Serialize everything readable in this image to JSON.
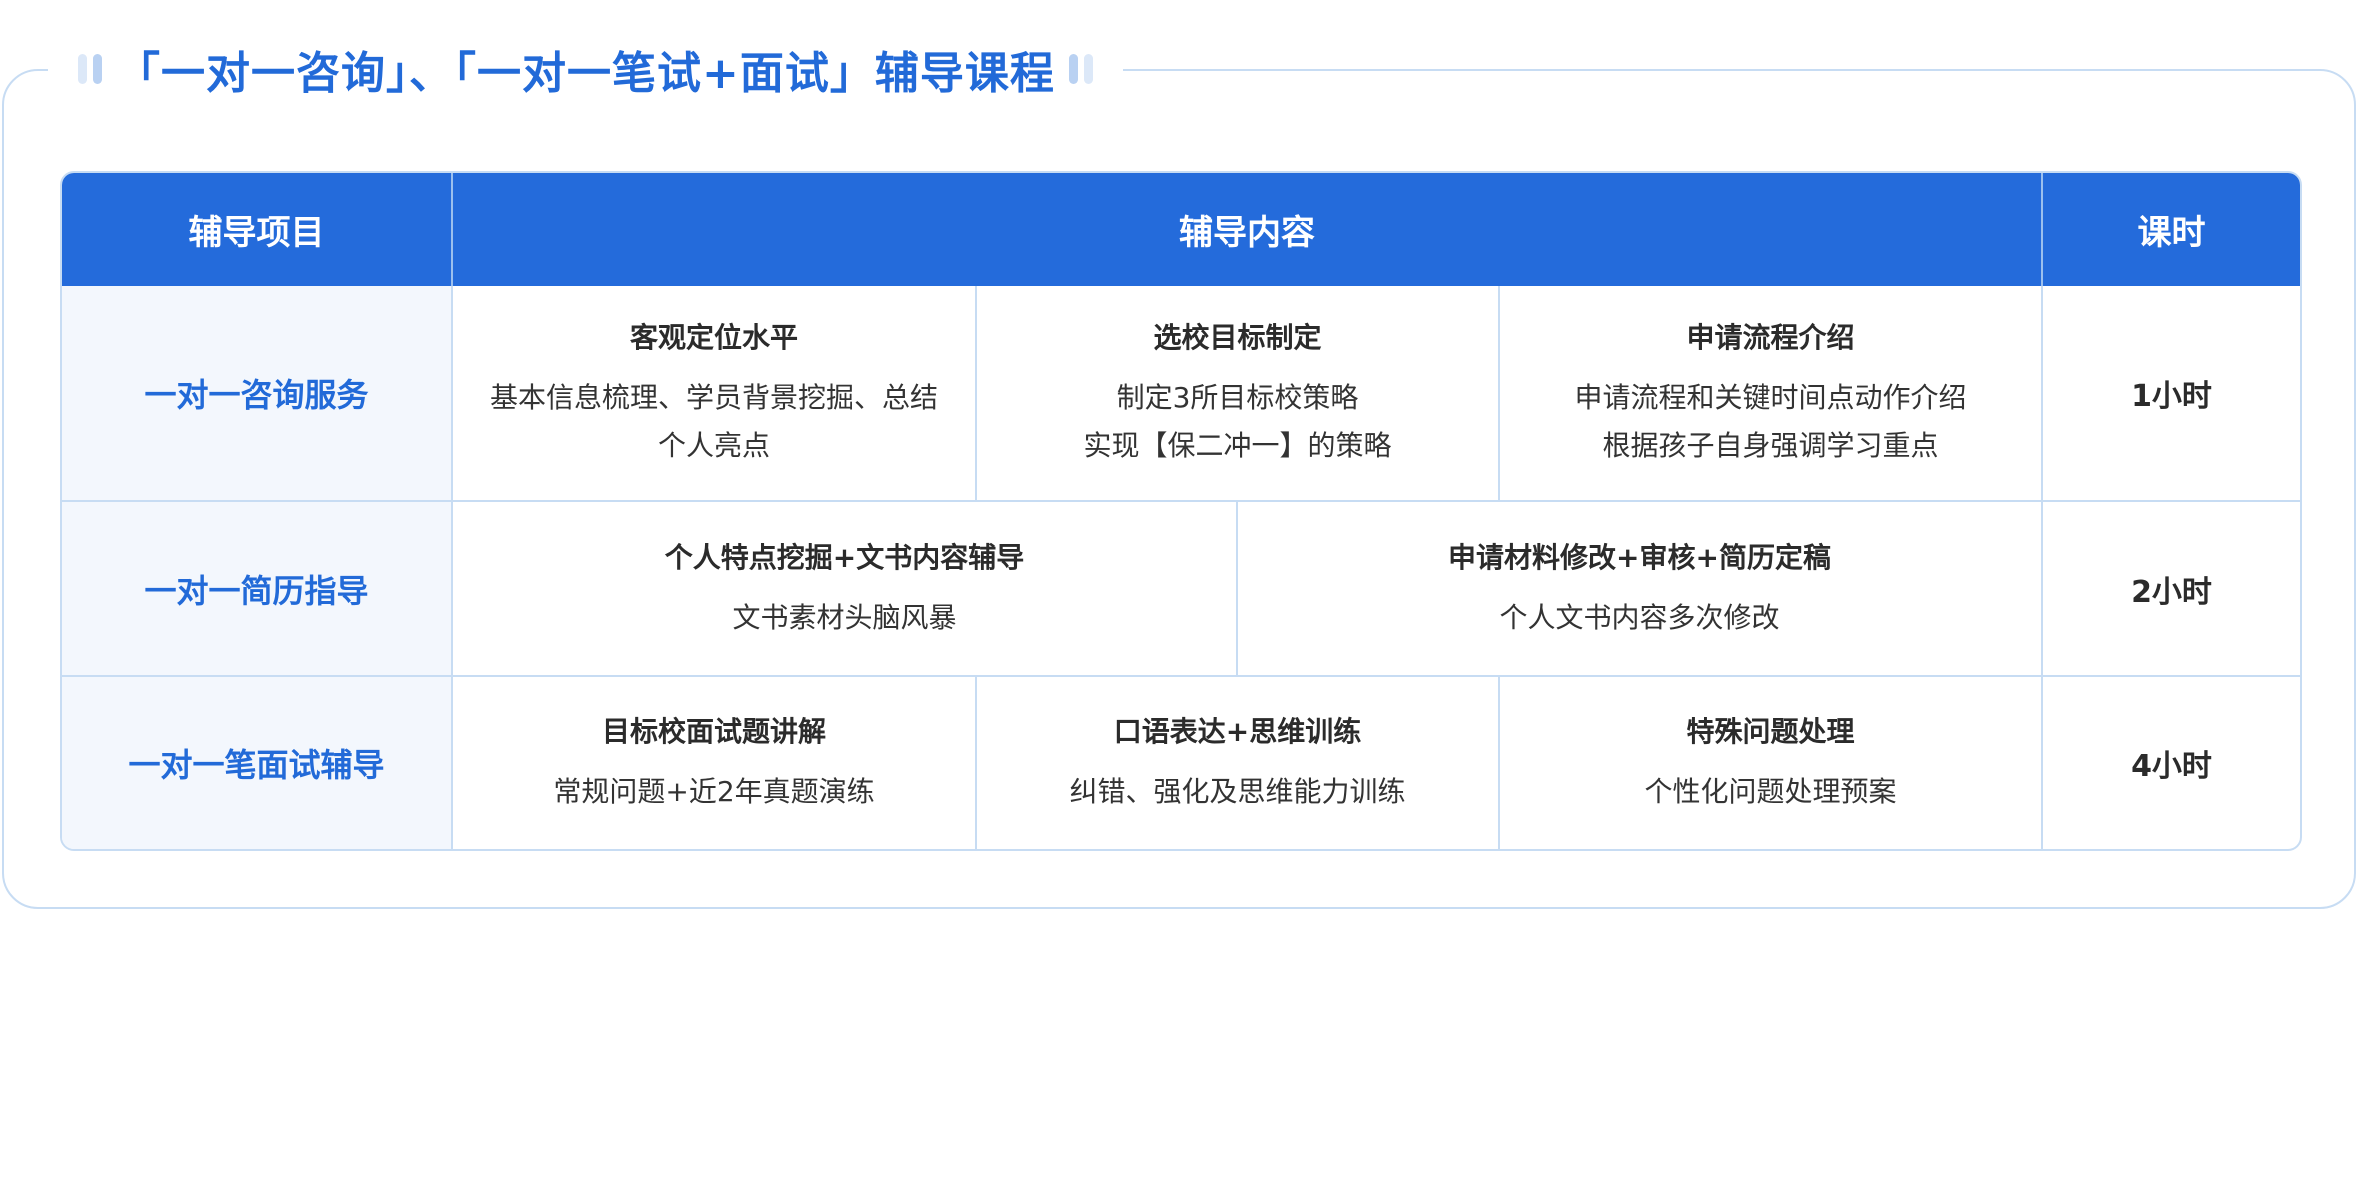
{
  "title": "「一对一咨询」、「一对一笔试+面试」辅导课程",
  "headers": {
    "project": "辅导项目",
    "content": "辅导内容",
    "hours": "课时"
  },
  "rows": [
    {
      "project": "一对一咨询服务",
      "hours": "1小时",
      "cells": [
        {
          "title": "客观定位水平",
          "lines": [
            "基本信息梳理、学员背景挖掘、总结",
            "个人亮点"
          ]
        },
        {
          "title": "选校目标制定",
          "lines": [
            "制定3所目标校策略",
            "实现【保二冲一】的策略"
          ]
        },
        {
          "title": "申请流程介绍",
          "lines": [
            "申请流程和关键时间点动作介绍",
            "根据孩子自身强调学习重点"
          ]
        }
      ]
    },
    {
      "project": "一对一简历指导",
      "hours": "2小时",
      "cells": [
        {
          "title": "个人特点挖掘+文书内容辅导",
          "lines": [
            "文书素材头脑风暴"
          ]
        },
        {
          "title": "申请材料修改+审核+简历定稿",
          "lines": [
            "个人文书内容多次修改"
          ]
        }
      ]
    },
    {
      "project": "一对一笔面试辅导",
      "hours": "4小时",
      "cells": [
        {
          "title": "目标校面试题讲解",
          "lines": [
            "常规问题+近2年真题演练"
          ]
        },
        {
          "title": "口语表达+思维训练",
          "lines": [
            "纠错、强化及思维能力训练"
          ]
        },
        {
          "title": "特殊问题处理",
          "lines": [
            "个性化问题处理预案"
          ]
        }
      ]
    }
  ]
}
